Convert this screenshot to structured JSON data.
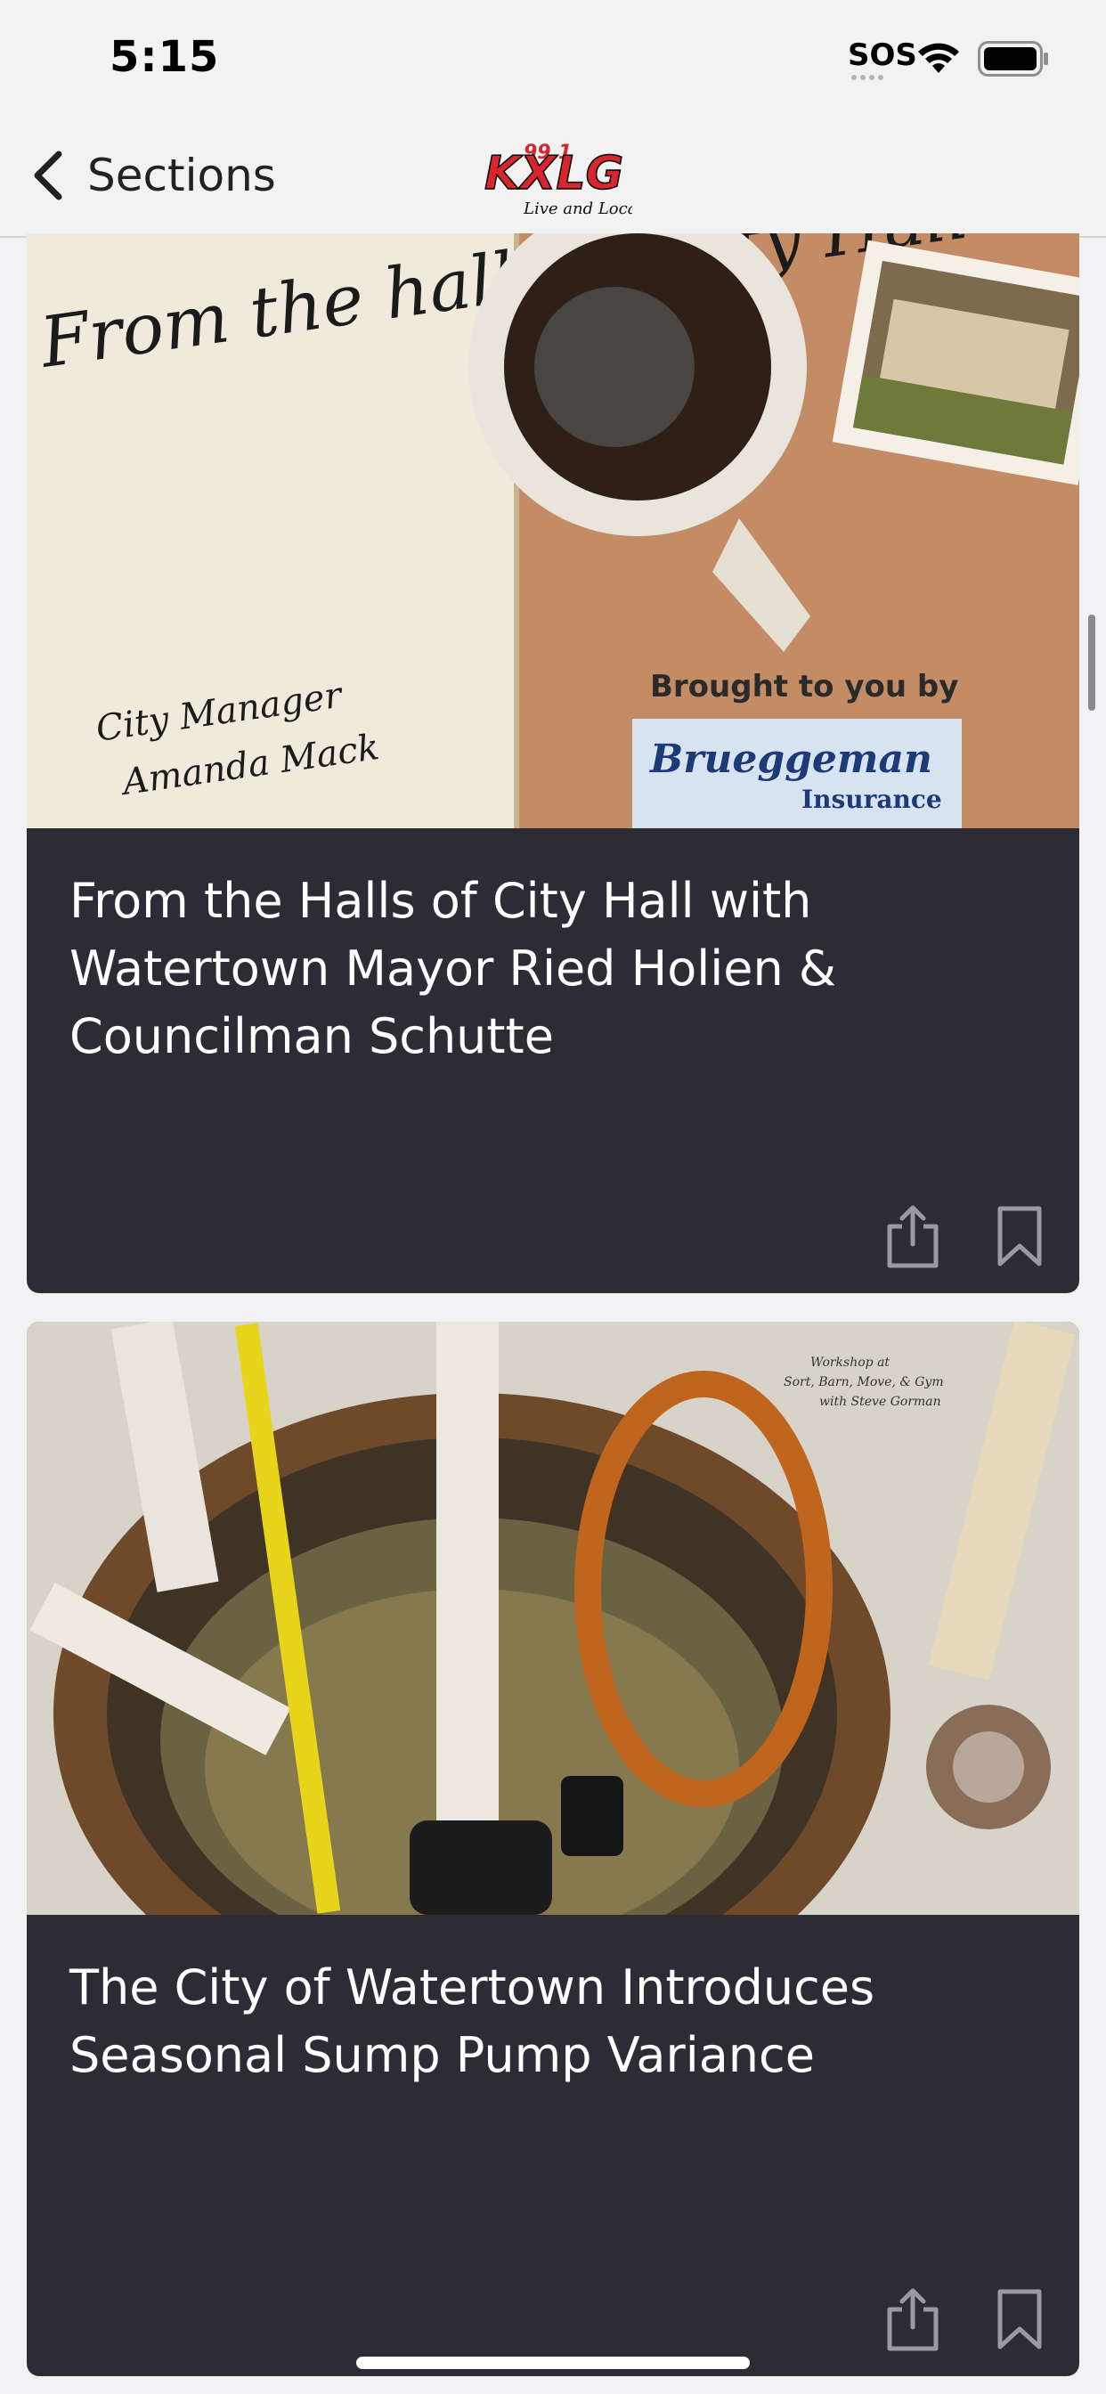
{
  "status_bar": {
    "time": "5:15",
    "carrier": "SOS",
    "icons": [
      "wifi-icon",
      "battery-icon"
    ]
  },
  "nav": {
    "back_label": "Sections",
    "back_icon": "chevron-left-icon",
    "logo": {
      "line1": "99.1",
      "line2": "KXLG",
      "tagline": "Live and Local"
    }
  },
  "articles": [
    {
      "title": "From the Halls of City Hall with Watertown Mayor Ried Holien & Councilman Schutte",
      "image": {
        "note_heading": "From the halls of City Hall",
        "note_sub1": "City Manager",
        "note_sub2": "Amanda Mack",
        "sponsor_label": "Brought to you by",
        "sponsor_name": "Brueggeman",
        "sponsor_sub": "Insurance"
      },
      "actions": [
        "share-icon",
        "bookmark-icon"
      ]
    },
    {
      "title": "The City of Watertown Introduces Seasonal Sump Pump Variance",
      "image": {
        "caption_line1": "Workshop at",
        "caption_line2": "Sort, Barn, Move, & Gym",
        "caption_line3": "with Steve Gorman"
      },
      "actions": [
        "share-icon",
        "bookmark-icon"
      ]
    }
  ],
  "colors": {
    "card_bg": "#2d2c35",
    "page_bg": "#f2f2f4",
    "title_text": "#ffffff",
    "logo_red": "#d7262e"
  }
}
